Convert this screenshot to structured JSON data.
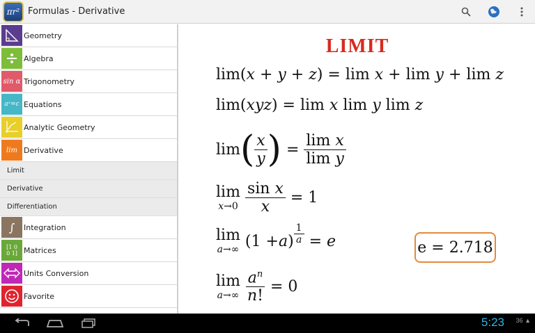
{
  "app": {
    "title": "Formulas - Derivative",
    "icon_text": "πr²",
    "icons": [
      "search-icon",
      "globe-icon",
      "overflow-menu-icon"
    ]
  },
  "sidebar": {
    "categories": [
      {
        "label": "Geometry",
        "icon": "triangle-icon",
        "color": "#5b3d8f"
      },
      {
        "label": "Algebra",
        "icon": "division-icon",
        "color": "#7dbd3a"
      },
      {
        "label": "Trigonometry",
        "icon": "sin-icon",
        "color": "#e05a6a",
        "icon_text": "sin α"
      },
      {
        "label": "Equations",
        "icon": "equation-icon",
        "color": "#45b7c6",
        "icon_text": "aˣ=c"
      },
      {
        "label": "Analytic Geometry",
        "icon": "graph-icon",
        "color": "#e8cf2a"
      },
      {
        "label": "Derivative",
        "icon": "lim-icon",
        "color": "#ef7a1e",
        "icon_text": "lim"
      }
    ],
    "subitems": [
      "Limit",
      "Derivative",
      "Differentiation"
    ],
    "more_categories": [
      {
        "label": "Integration",
        "icon": "integral-icon",
        "color": "#8a7560"
      },
      {
        "label": "Matrices",
        "icon": "matrix-icon",
        "color": "#6aa83a"
      },
      {
        "label": "Units Conversion",
        "icon": "arrows-icon",
        "color": "#c028b6"
      },
      {
        "label": "Favorite",
        "icon": "smiley-icon",
        "color": "#e0242f"
      }
    ]
  },
  "content": {
    "heading": "LIMIT",
    "e_value": "e = 2.718"
  },
  "navbar": {
    "clock": "5:23",
    "status": "36 ▲"
  }
}
